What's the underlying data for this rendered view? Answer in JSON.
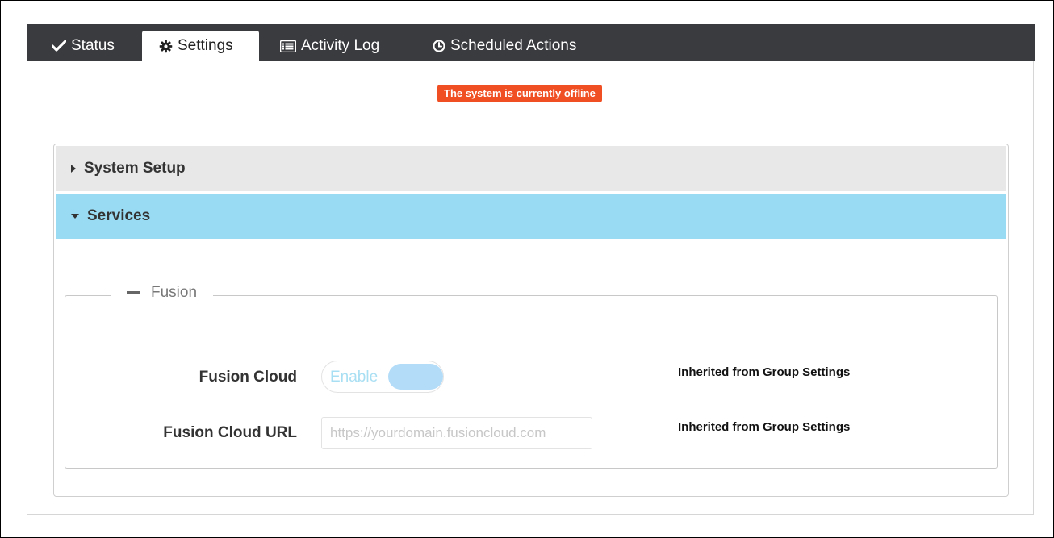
{
  "tabs": [
    {
      "label": "Status",
      "icon": "check-icon"
    },
    {
      "label": "Settings",
      "icon": "gear-icon",
      "active": true
    },
    {
      "label": "Activity Log",
      "icon": "list-icon"
    },
    {
      "label": "Scheduled Actions",
      "icon": "clock-icon"
    }
  ],
  "status_banner": {
    "text": "The system is currently offline",
    "color": "#f04e23"
  },
  "accordion": {
    "system_setup": {
      "label": "System Setup",
      "expanded": false
    },
    "services": {
      "label": "Services",
      "expanded": true
    }
  },
  "fusion": {
    "legend": "Fusion",
    "cloud": {
      "label": "Fusion Cloud",
      "toggle_text": "Enable",
      "note": "Inherited from Group Settings"
    },
    "url": {
      "label": "Fusion Cloud URL",
      "placeholder": "https://yourdomain.fusioncloud.com",
      "value": "",
      "note": "Inherited from Group Settings"
    }
  },
  "colors": {
    "tabbar": "#3a3b3f",
    "services_header": "#99dbf3",
    "system_header": "#e8e8e8",
    "toggle_knob": "#b3dcf8"
  }
}
